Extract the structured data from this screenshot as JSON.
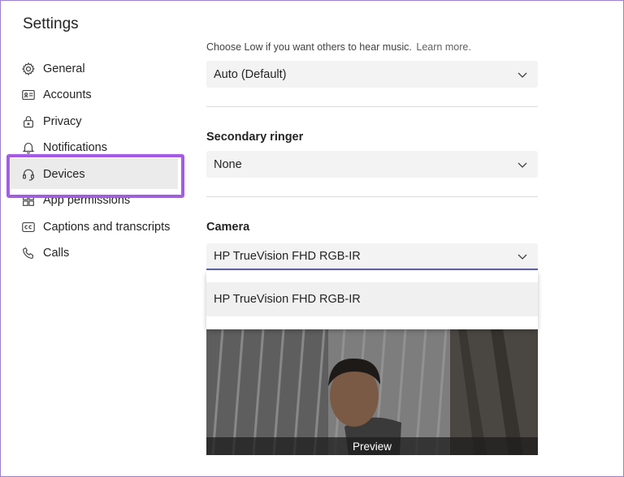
{
  "page": {
    "title": "Settings"
  },
  "sidebar": {
    "items": [
      {
        "label": "General",
        "icon": "gear-icon"
      },
      {
        "label": "Accounts",
        "icon": "id-card-icon"
      },
      {
        "label": "Privacy",
        "icon": "lock-icon"
      },
      {
        "label": "Notifications",
        "icon": "bell-icon"
      },
      {
        "label": "Devices",
        "icon": "headset-icon",
        "selected": true
      },
      {
        "label": "App permissions",
        "icon": "grid-icon"
      },
      {
        "label": "Captions and transcripts",
        "icon": "cc-icon"
      },
      {
        "label": "Calls",
        "icon": "phone-icon"
      }
    ]
  },
  "main": {
    "hint_text": "Choose Low if you want others to hear music.",
    "learn_more": "Learn more.",
    "noise_select_value": "Auto (Default)",
    "secondary_ringer": {
      "label": "Secondary ringer",
      "value": "None"
    },
    "camera": {
      "label": "Camera",
      "value": "HP TrueVision FHD RGB-IR",
      "dropdown_options": [
        "HP TrueVision FHD RGB-IR"
      ]
    },
    "preview_label": "Preview"
  },
  "colors": {
    "highlight_border": "#a35be8",
    "selected_bg": "#ebebeb",
    "accent_underline": "#5b5fc7"
  }
}
